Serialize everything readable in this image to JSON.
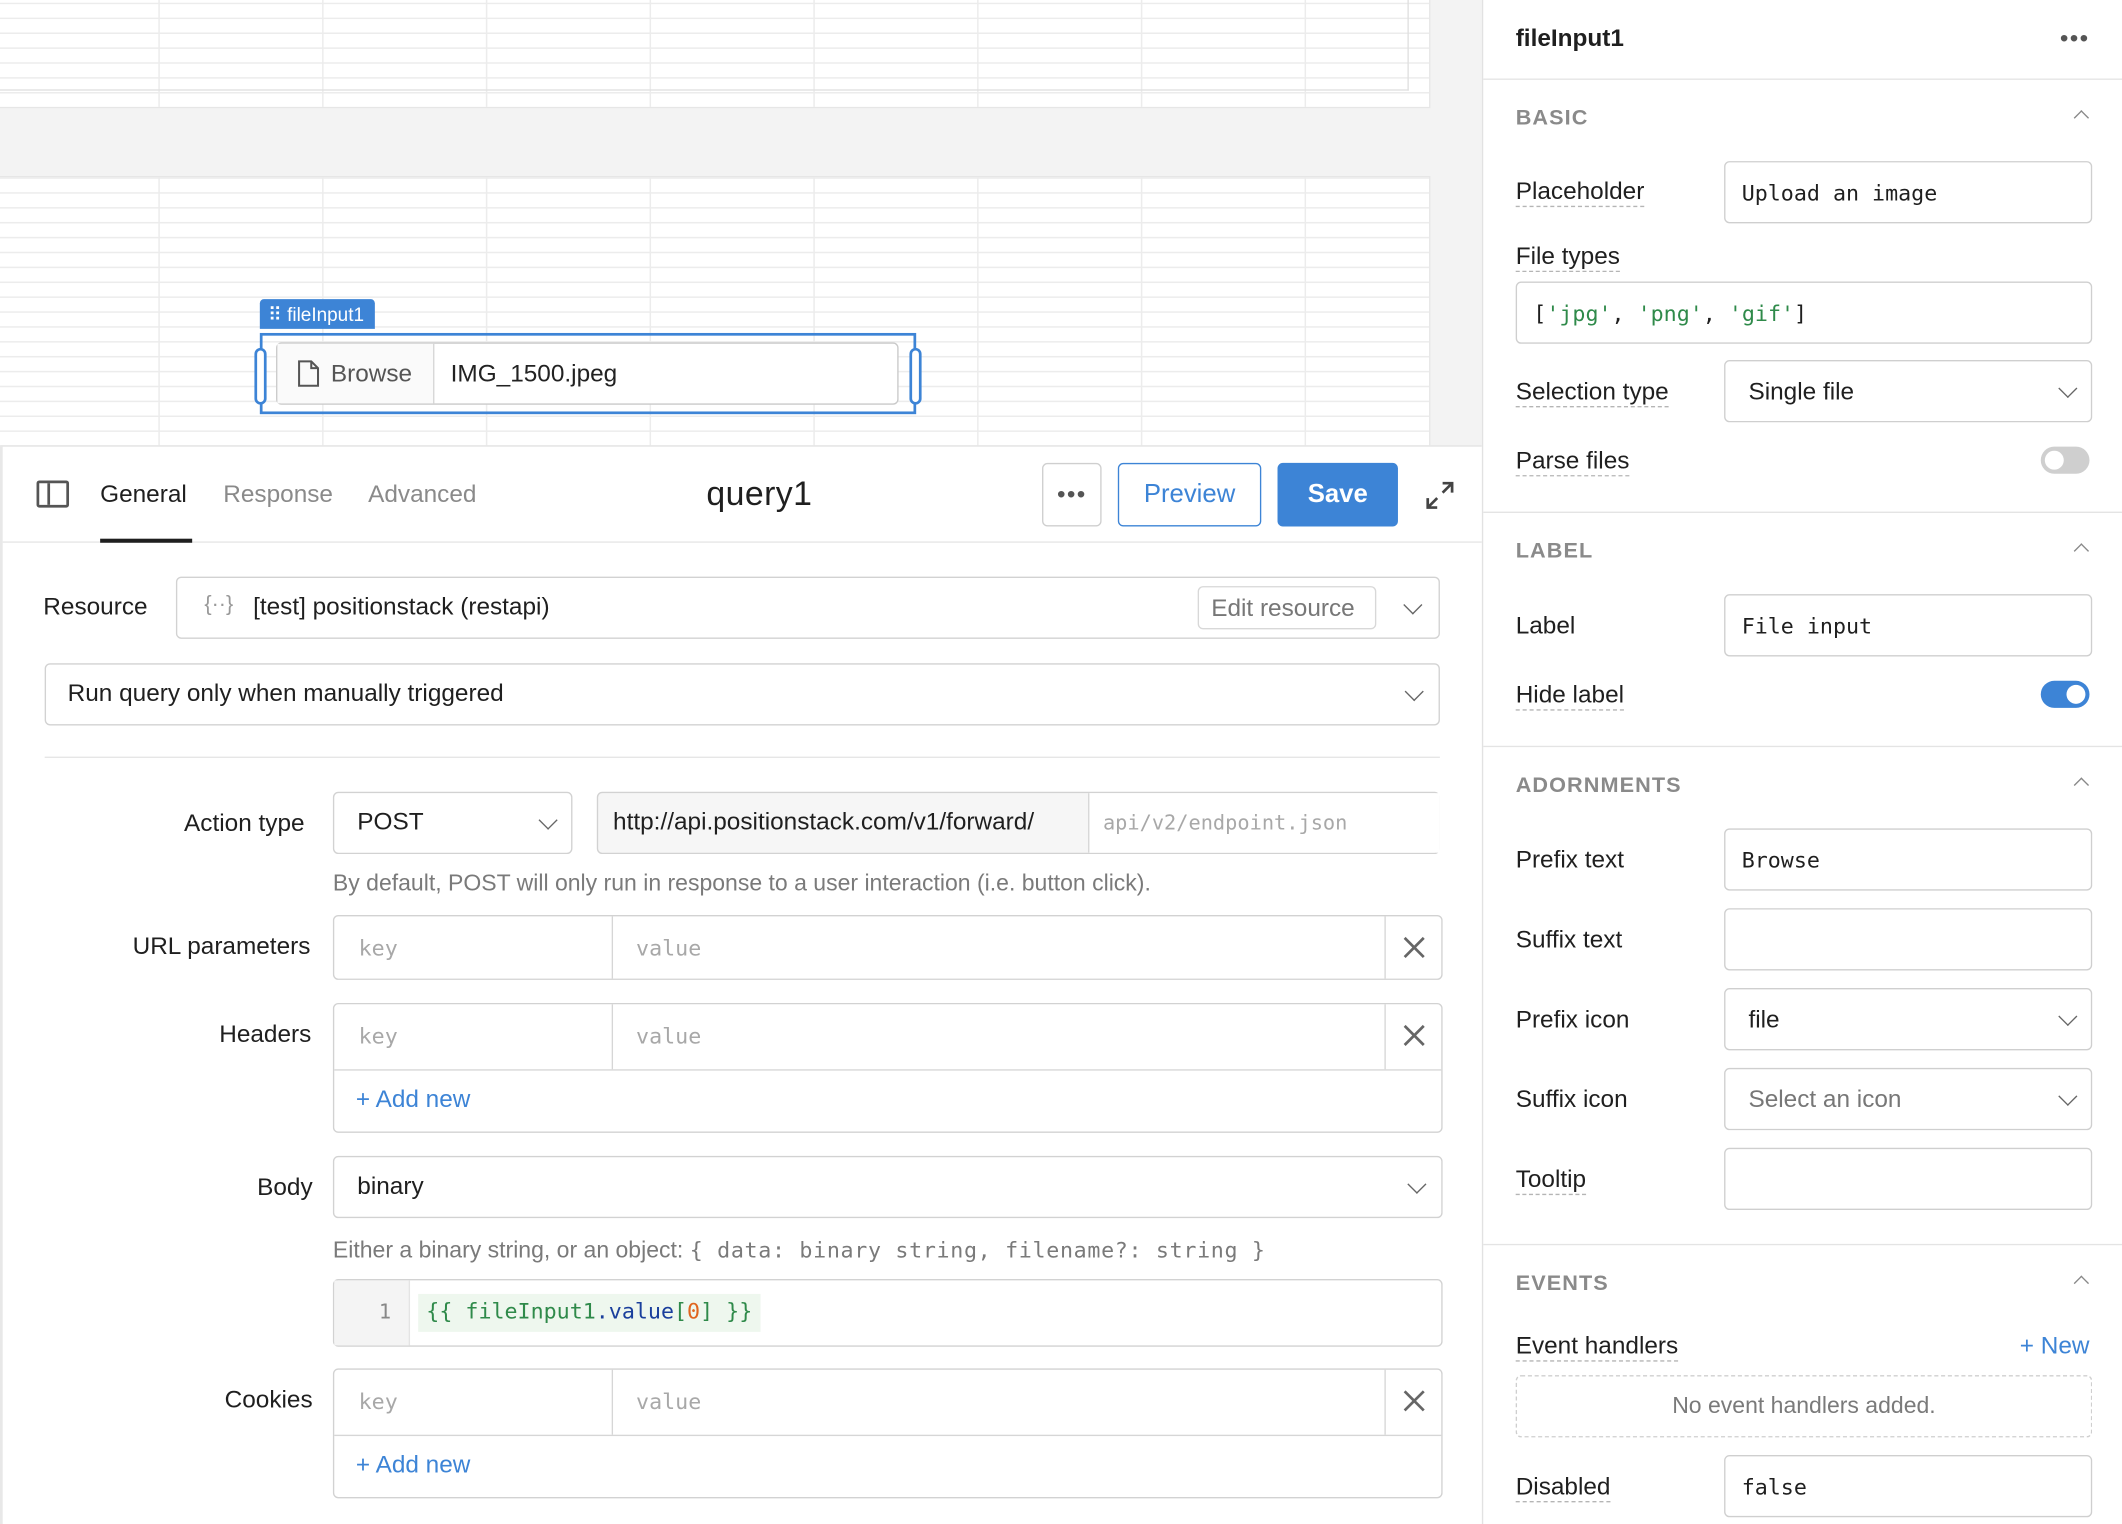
{
  "canvas": {
    "file_input_tag": "fileInput1",
    "file_input_prefix": "Browse",
    "file_input_value": "IMG_1500.jpeg"
  },
  "query": {
    "tabs": [
      "General",
      "Response",
      "Advanced"
    ],
    "active_tab": "General",
    "title": "query1",
    "more_label": "•••",
    "preview_label": "Preview",
    "save_label": "Save",
    "resource_label": "Resource",
    "resource_value": "[test] positionstack (restapi)",
    "edit_resource_label": "Edit resource",
    "trigger_value": "Run query only when manually triggered",
    "action_type_label": "Action type",
    "action_type_value": "POST",
    "url_base": "http://api.positionstack.com/v1/forward/",
    "url_placeholder": "api/v2/endpoint.json",
    "action_help": "By default, POST will only run in response to a user interaction (i.e. button click).",
    "url_params_label": "URL parameters",
    "headers_label": "Headers",
    "key_placeholder": "key",
    "value_placeholder": "value",
    "add_new_label": "+ Add new",
    "body_label": "Body",
    "body_type": "binary",
    "body_help_prefix": "Either a binary string, or an object: ",
    "body_help_code": "{ data: binary string, filename?: string }",
    "code_line_number": "1",
    "code_open": "{{ ",
    "code_ident": "fileInput1",
    "code_prop": ".value",
    "code_bracket_open": "[",
    "code_index": "0",
    "code_bracket_close": "]",
    "code_close": " }}",
    "cookies_label": "Cookies"
  },
  "sidebar": {
    "title": "fileInput1",
    "more_label": "•••",
    "basic": {
      "title": "BASIC",
      "placeholder_label": "Placeholder",
      "placeholder_value": "Upload an image",
      "file_types_label": "File types",
      "file_types_open": "[",
      "file_types_items": [
        "'jpg'",
        "'png'",
        "'gif'"
      ],
      "file_types_sep": ", ",
      "file_types_close": "]",
      "selection_type_label": "Selection type",
      "selection_type_value": "Single file",
      "parse_files_label": "Parse files",
      "parse_files_on": false
    },
    "label": {
      "title": "LABEL",
      "label_label": "Label",
      "label_value": "File input",
      "hide_label_label": "Hide label",
      "hide_label_on": true
    },
    "adornments": {
      "title": "ADORNMENTS",
      "prefix_text_label": "Prefix text",
      "prefix_text_value": "Browse",
      "suffix_text_label": "Suffix text",
      "suffix_text_value": "",
      "prefix_icon_label": "Prefix icon",
      "prefix_icon_value": "file",
      "suffix_icon_label": "Suffix icon",
      "suffix_icon_value": "Select an icon",
      "tooltip_label": "Tooltip",
      "tooltip_value": ""
    },
    "events": {
      "title": "EVENTS",
      "handlers_label": "Event handlers",
      "new_label": "+ New",
      "empty_text": "No event handlers added.",
      "disabled_label": "Disabled",
      "disabled_placeholder": "false"
    }
  },
  "colors": {
    "accent": "#3d84d6",
    "toggle_off": "#cfcfcf"
  }
}
